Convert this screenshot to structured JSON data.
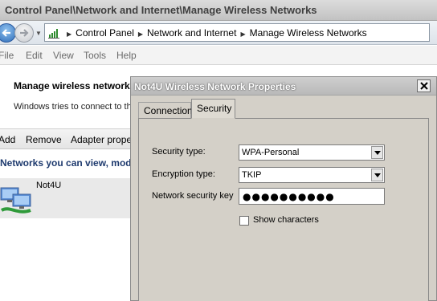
{
  "window": {
    "title": "Control Panel\\Network and Internet\\Manage Wireless Networks"
  },
  "address": {
    "crumbs": [
      "Control Panel",
      "Network and Internet",
      "Manage Wireless Networks"
    ]
  },
  "menu": {
    "items": [
      "File",
      "Edit",
      "View",
      "Tools",
      "Help"
    ]
  },
  "content": {
    "heading": "Manage wireless network",
    "description": "Windows tries to connect to th"
  },
  "toolbar": {
    "items": [
      "Add",
      "Remove",
      "Adapter proper"
    ]
  },
  "networks": {
    "header": "Networks you can view, modif",
    "items": [
      {
        "name": "Not4U"
      }
    ]
  },
  "dialog": {
    "title": "Not4U Wireless Network Properties",
    "tabs": [
      "Connection",
      "Security"
    ],
    "active_tab": "Security",
    "security_type_label": "Security type:",
    "security_type_value": "WPA-Personal",
    "encryption_type_label": "Encryption type:",
    "encryption_type_value": "TKIP",
    "network_key_label": "Network security key",
    "network_key_value": "●●●●●●●●●●",
    "show_characters_label": "Show characters",
    "show_characters_checked": false
  },
  "colors": {
    "nav_back": "#2f6db8",
    "network_header": "#1e3a6e",
    "dialog_face": "#d4d0c8"
  },
  "icons": [
    "back-arrow-icon",
    "forward-arrow-icon",
    "network-signal-icon",
    "wireless-network-icon",
    "close-icon",
    "dropdown-arrow-icon"
  ]
}
